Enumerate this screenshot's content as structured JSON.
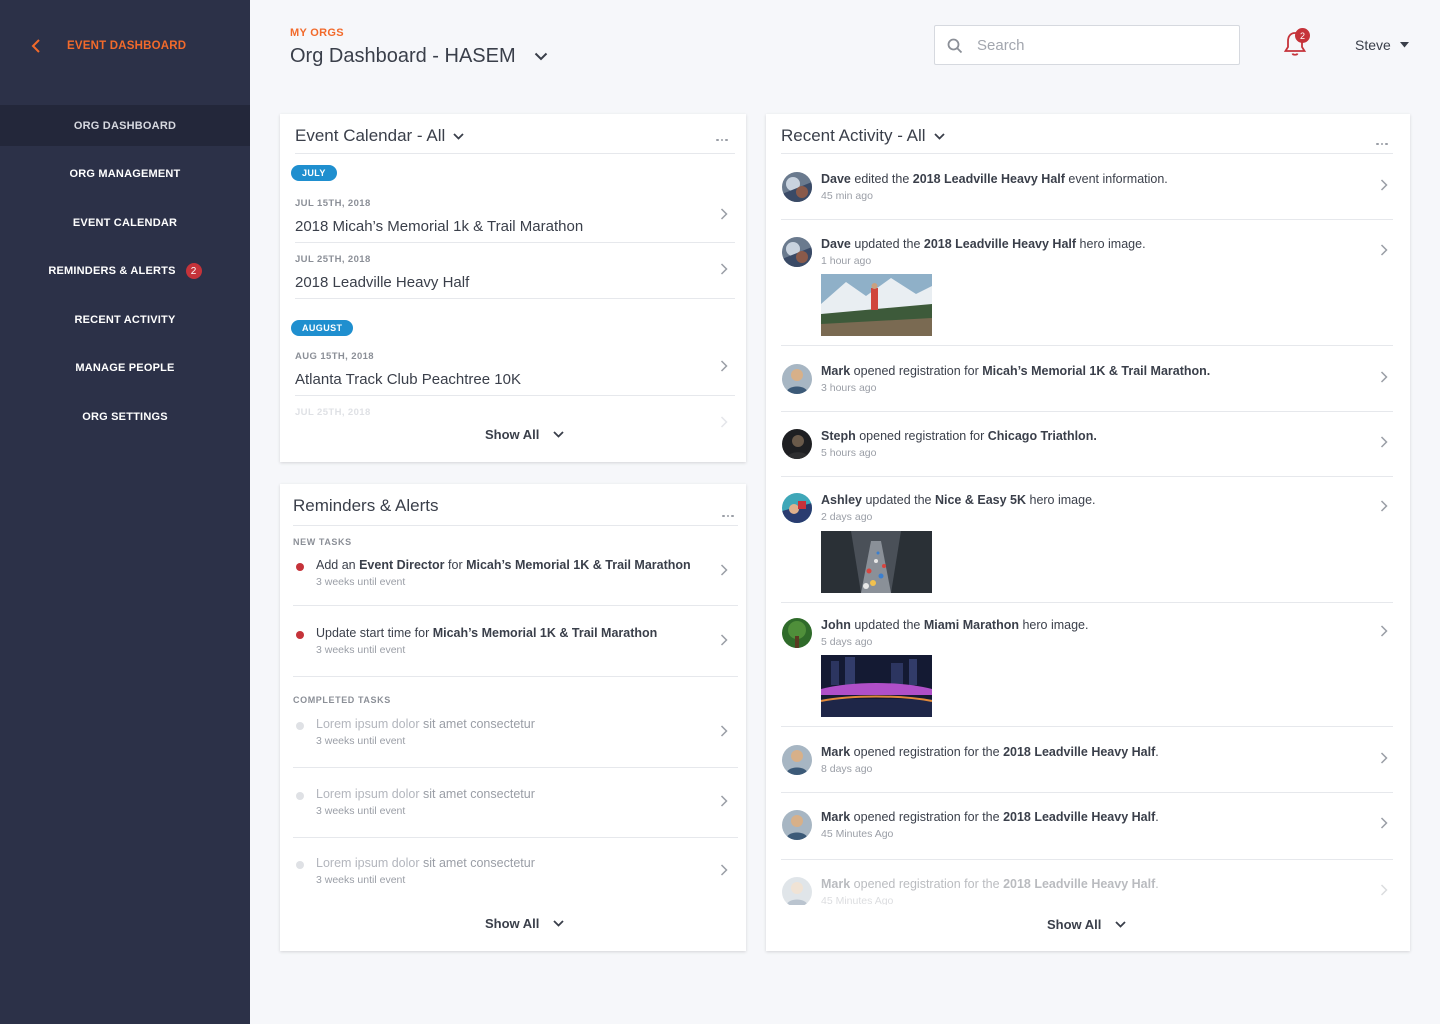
{
  "sidebar": {
    "back_label": "EVENT DASHBOARD",
    "items": [
      {
        "label": "ORG DASHBOARD"
      },
      {
        "label": "ORG MANAGEMENT"
      },
      {
        "label": "EVENT CALENDAR"
      },
      {
        "label": "REMINDERS & ALERTS",
        "badge": "2"
      },
      {
        "label": "RECENT ACTIVITY"
      },
      {
        "label": "MANAGE PEOPLE"
      },
      {
        "label": "ORG SETTINGS"
      }
    ]
  },
  "header": {
    "breadcrumb": "MY ORGS",
    "title": "Org Dashboard - HASEM",
    "search_placeholder": "Search",
    "notification_count": "2",
    "user_name": "Steve"
  },
  "colors": {
    "accent": "#f26a2b",
    "sidebar": "#2c3148",
    "pill": "#1f8fcf",
    "alert": "#c5333a"
  },
  "event_calendar": {
    "title": "Event Calendar - All",
    "months": [
      {
        "label": "JULY"
      },
      {
        "label": "AUGUST"
      }
    ],
    "events": [
      {
        "date": "JUL 15TH, 2018",
        "name": "2018 Micah’s Memorial 1k & Trail Marathon"
      },
      {
        "date": "JUL 25TH, 2018",
        "name": "2018 Leadville Heavy Half"
      },
      {
        "date": "AUG 15TH, 2018",
        "name": "Atlanta Track Club Peachtree 10K"
      },
      {
        "date": "JUL 25TH, 2018",
        "name": ""
      }
    ],
    "show_all": "Show All"
  },
  "reminders": {
    "title": "Reminders & Alerts",
    "new_label": "NEW TASKS",
    "completed_label": "COMPLETED TASKS",
    "new_tasks": [
      {
        "pre": "Add an ",
        "bold1": "Event Director",
        "mid": " for ",
        "bold2": "Micah’s Memorial 1K & Trail Marathon",
        "sub": "3 weeks until event"
      },
      {
        "pre": "Update start time for ",
        "bold1": "Micah’s Memorial 1K & Trail Marathon",
        "mid": "",
        "bold2": "",
        "sub": "3 weeks until event"
      }
    ],
    "completed_tasks": [
      {
        "pre": "Lorem ipsum dolor ",
        "bold1": "sit amet consectetur",
        "sub": "3 weeks until event"
      },
      {
        "pre": "Lorem ipsum dolor ",
        "bold1": "sit amet consectetur",
        "sub": "3 weeks until event"
      },
      {
        "pre": "Lorem ipsum dolor ",
        "bold1": "sit amet consectetur",
        "sub": "3 weeks until event"
      }
    ],
    "show_all": "Show All"
  },
  "activity": {
    "title": "Recent Activity - All",
    "items": [
      {
        "who": "Dave",
        "verb": " edited the ",
        "target": "2018 Leadville Heavy Half",
        "rest": " event information.",
        "time": "45 min ago",
        "avatar": "avatar-dave"
      },
      {
        "who": "Dave",
        "verb": " updated the ",
        "target": "2018 Leadville Heavy Half",
        "rest": " hero image.",
        "time": "1 hour ago",
        "avatar": "avatar-dave",
        "thumb": "mountain-runner-image"
      },
      {
        "who": "Mark",
        "verb": " opened registration for ",
        "target": "Micah’s Memorial 1K & Trail Marathon.",
        "rest": "",
        "time": "3 hours ago",
        "avatar": "avatar-mark"
      },
      {
        "who": "Steph",
        "verb": " opened registration for ",
        "target": "Chicago Triathlon.",
        "rest": "",
        "time": "5 hours ago",
        "avatar": "avatar-steph"
      },
      {
        "who": "Ashley",
        "verb": " updated the ",
        "target": "Nice & Easy 5K",
        "rest": " hero image.",
        "time": "2 days ago",
        "avatar": "avatar-ashley",
        "thumb": "marathon-crowd-image"
      },
      {
        "who": "John",
        "verb": " updated the ",
        "target": "Miami Marathon",
        "rest": " hero image.",
        "time": "5 days ago",
        "avatar": "avatar-john",
        "thumb": "night-bridge-image"
      },
      {
        "who": "Mark",
        "verb": " opened registration for the ",
        "target": "2018 Leadville Heavy Half",
        "rest": ".",
        "time": "8 days ago",
        "avatar": "avatar-mark"
      },
      {
        "who": "Mark",
        "verb": " opened registration for the ",
        "target": "2018 Leadville Heavy Half",
        "rest": ".",
        "time": "45 Minutes Ago",
        "avatar": "avatar-mark"
      },
      {
        "who": "Mark",
        "verb": " opened registration for the ",
        "target": "2018 Leadville Heavy Half",
        "rest": ".",
        "time": "45 Minutes Ago",
        "avatar": "avatar-mark"
      }
    ],
    "show_all": "Show All"
  }
}
